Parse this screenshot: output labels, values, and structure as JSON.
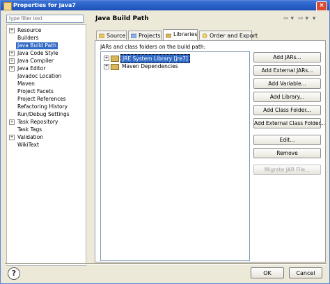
{
  "window": {
    "title": "Properties for java7",
    "close_glyph": "×"
  },
  "filter": {
    "placeholder": "type filter text"
  },
  "tree": {
    "items": [
      {
        "label": "Resource",
        "expandable": true
      },
      {
        "label": "Builders",
        "expandable": false
      },
      {
        "label": "Java Build Path",
        "expandable": false,
        "selected": true
      },
      {
        "label": "Java Code Style",
        "expandable": true
      },
      {
        "label": "Java Compiler",
        "expandable": true
      },
      {
        "label": "Java Editor",
        "expandable": true
      },
      {
        "label": "Javadoc Location",
        "expandable": false
      },
      {
        "label": "Maven",
        "expandable": false
      },
      {
        "label": "Project Facets",
        "expandable": false
      },
      {
        "label": "Project References",
        "expandable": false
      },
      {
        "label": "Refactoring History",
        "expandable": false
      },
      {
        "label": "Run/Debug Settings",
        "expandable": false
      },
      {
        "label": "Task Repository",
        "expandable": true
      },
      {
        "label": "Task Tags",
        "expandable": false
      },
      {
        "label": "Validation",
        "expandable": true
      },
      {
        "label": "WikiText",
        "expandable": false
      }
    ]
  },
  "header": {
    "title": "Java Build Path"
  },
  "nav": {
    "back": "⇦",
    "back_menu": "▾",
    "forward": "⇨",
    "forward_menu": "▾",
    "more": "▾"
  },
  "tabs": [
    {
      "label": "Source",
      "icon": "source-folder-icon"
    },
    {
      "label": "Projects",
      "icon": "projects-icon"
    },
    {
      "label": "Libraries",
      "icon": "libraries-icon",
      "active": true
    },
    {
      "label": "Order and Export",
      "icon": "order-export-icon"
    }
  ],
  "libraries": {
    "caption": "JARs and class folders on the build path:",
    "items": [
      {
        "label": "JRE System Library [jre7]",
        "selected": true
      },
      {
        "label": "Maven Dependencies",
        "selected": false
      }
    ]
  },
  "buttons": {
    "add_jars": "Add JARs...",
    "add_external_jars": "Add External JARs...",
    "add_variable": "Add Variable...",
    "add_library": "Add Library...",
    "add_class_folder": "Add Class Folder...",
    "add_external_class_folder": "Add External Class Folder...",
    "edit": "Edit...",
    "remove": "Remove",
    "migrate_jar": "Migrate JAR File..."
  },
  "footer": {
    "help_glyph": "?",
    "ok": "OK",
    "cancel": "Cancel"
  },
  "colors": {
    "titlebar": "#1c4fb8",
    "selection": "#316ac5",
    "dialog_bg": "#ece9d8"
  }
}
